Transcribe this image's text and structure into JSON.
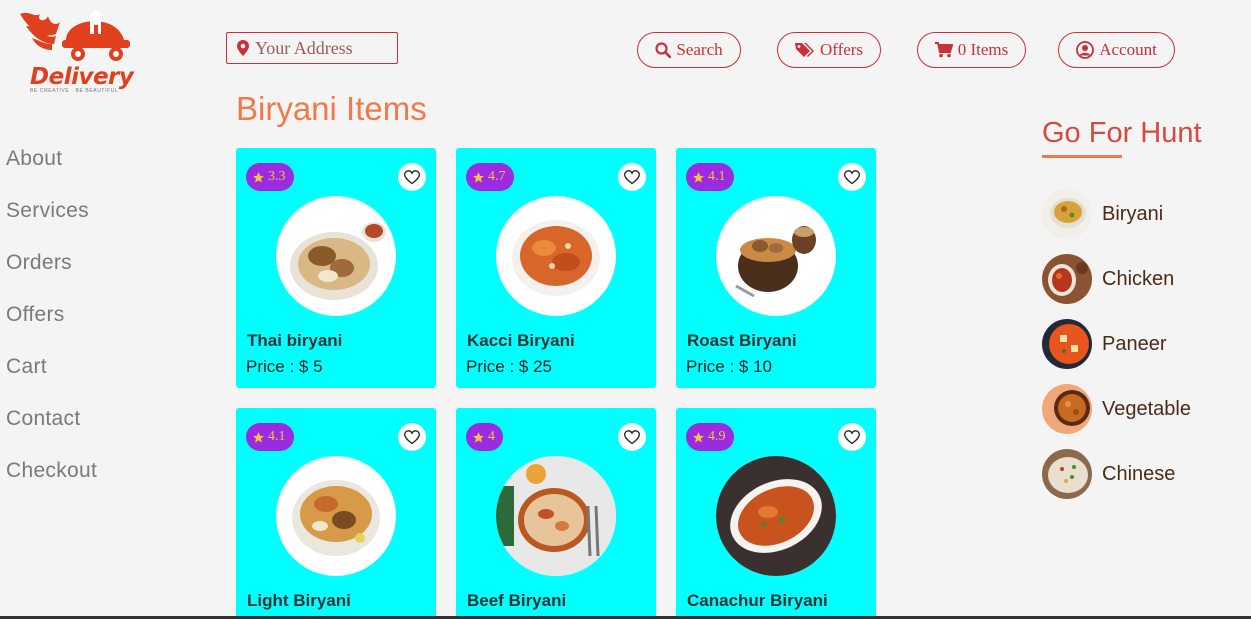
{
  "brand": {
    "name": "Delivery",
    "tagline": "BE CREATIVE · BE BEAUTIFUL",
    "color": "#e0401e"
  },
  "header": {
    "address_placeholder": "Your Address",
    "buttons": [
      {
        "label": "Search",
        "icon": "search-icon"
      },
      {
        "label": "Offers",
        "icon": "tags-icon"
      },
      {
        "label": "0 Items",
        "icon": "cart-icon"
      },
      {
        "label": "Account",
        "icon": "user-circle-icon"
      }
    ]
  },
  "sidebar": {
    "items": [
      {
        "label": "About"
      },
      {
        "label": "Services"
      },
      {
        "label": "Orders"
      },
      {
        "label": "Offers"
      },
      {
        "label": "Cart"
      },
      {
        "label": "Contact"
      },
      {
        "label": "Checkout"
      }
    ]
  },
  "main": {
    "title": "Biryani Items",
    "items": [
      {
        "name": "Thai biryani",
        "price": "Price : $ 5",
        "rating": "3.3"
      },
      {
        "name": "Kacci Biryani",
        "price": "Price : $ 25",
        "rating": "4.7"
      },
      {
        "name": "Roast Biryani",
        "price": "Price : $ 10",
        "rating": "4.1"
      },
      {
        "name": "Light Biryani",
        "price": "",
        "rating": "4.1"
      },
      {
        "name": "Beef Biryani",
        "price": "",
        "rating": "4"
      },
      {
        "name": "Canachur Biryani",
        "price": "",
        "rating": "4.9"
      }
    ]
  },
  "hunt": {
    "title": "Go For Hunt",
    "categories": [
      {
        "label": "Biryani"
      },
      {
        "label": "Chicken"
      },
      {
        "label": "Paneer"
      },
      {
        "label": "Vegetable"
      },
      {
        "label": "Chinese"
      }
    ]
  },
  "colors": {
    "accent": "#c8303a",
    "card_bg": "#00ffff",
    "rating_bg": "#9b2ae0",
    "star": "#f7c53a",
    "title": "#f07a4a"
  }
}
